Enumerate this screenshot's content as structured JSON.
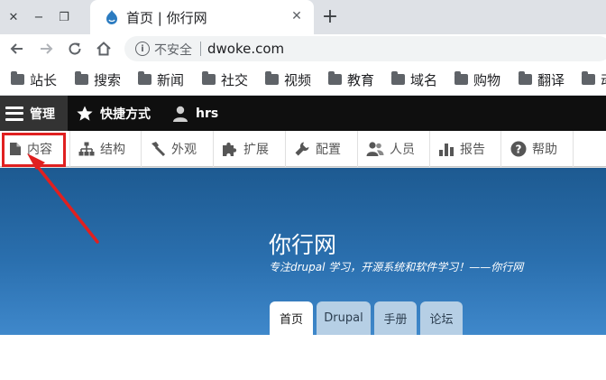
{
  "browser": {
    "window_controls": {
      "close": "✕",
      "minimize": "−",
      "restore": "❐"
    },
    "tab": {
      "title": "首页 | 你行网",
      "close": "✕"
    },
    "new_tab": "+",
    "omnibox": {
      "security_text": "不安全",
      "url": "dwoke.com"
    },
    "bookmarks": [
      {
        "label": "站长"
      },
      {
        "label": "搜索"
      },
      {
        "label": "新闻"
      },
      {
        "label": "社交"
      },
      {
        "label": "视频"
      },
      {
        "label": "教育"
      },
      {
        "label": "域名"
      },
      {
        "label": "购物"
      },
      {
        "label": "翻译"
      },
      {
        "label": "动"
      }
    ]
  },
  "admin_toolbar": {
    "manage": "管理",
    "shortcuts": "快捷方式",
    "user": "hrs"
  },
  "admin_tray": {
    "items": [
      {
        "label": "内容",
        "icon": "file-icon"
      },
      {
        "label": "结构",
        "icon": "sitemap-icon"
      },
      {
        "label": "外观",
        "icon": "paintbrush-icon"
      },
      {
        "label": "扩展",
        "icon": "puzzle-icon"
      },
      {
        "label": "配置",
        "icon": "wrench-icon"
      },
      {
        "label": "人员",
        "icon": "people-icon"
      },
      {
        "label": "报告",
        "icon": "bar-chart-icon"
      },
      {
        "label": "帮助",
        "icon": "help-icon"
      }
    ]
  },
  "site": {
    "name": "你行网",
    "slogan": "专注drupal 学习，开源系统和软件学习！——你行网",
    "tabs": [
      {
        "label": "首页",
        "active": true
      },
      {
        "label": "Drupal",
        "active": false
      },
      {
        "label": "手册",
        "active": false
      },
      {
        "label": "论坛",
        "active": false
      }
    ]
  },
  "colors": {
    "annotation_red": "#e02020",
    "hero_blue": "#2a6fae",
    "admin_bar": "#0f0f0f"
  }
}
